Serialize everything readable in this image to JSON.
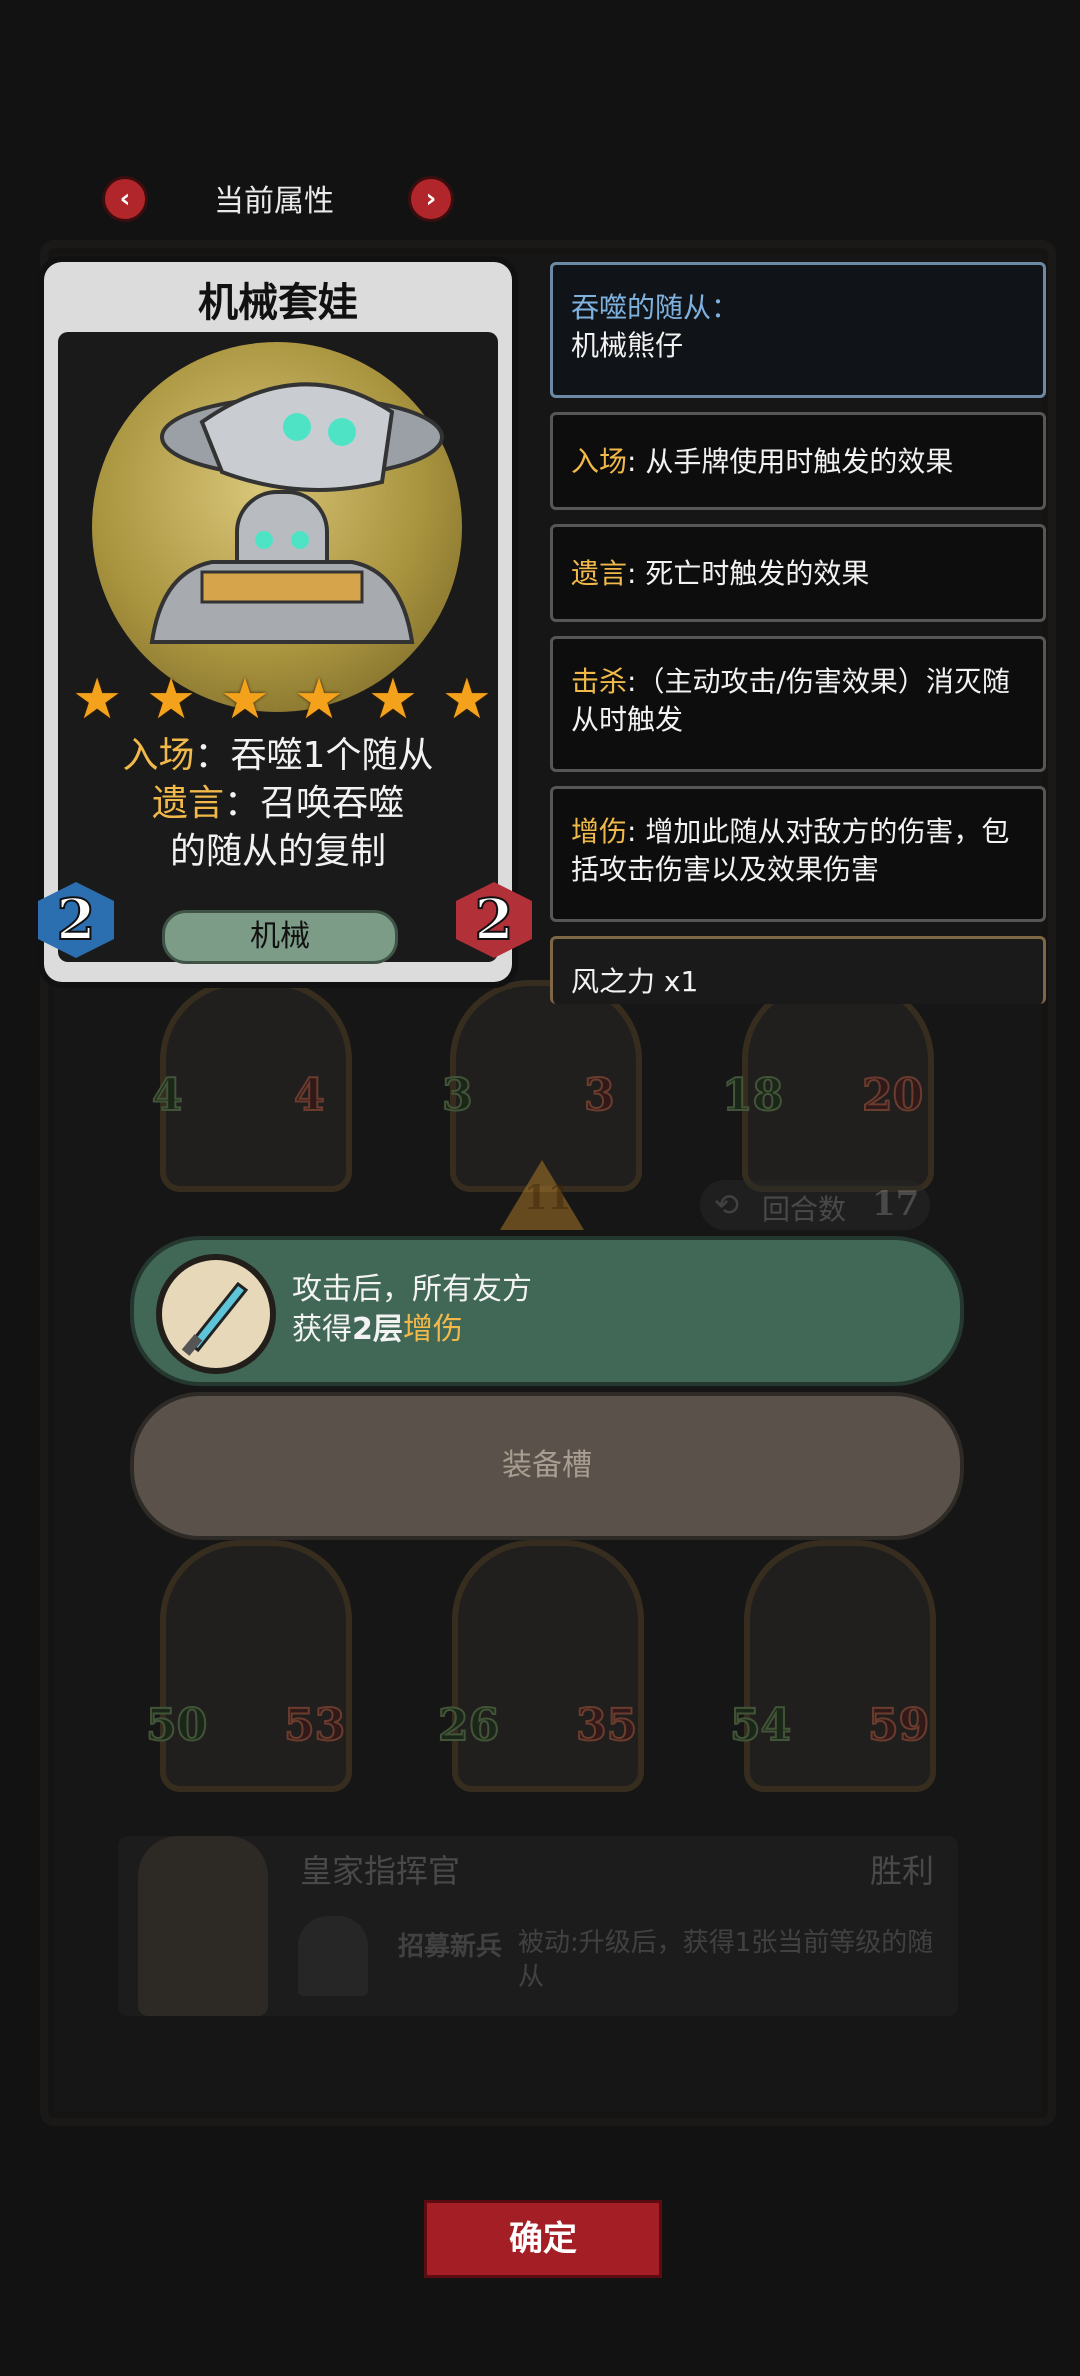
{
  "header": {
    "title": "当前属性"
  },
  "card": {
    "name": "机械套娃",
    "stars": 6,
    "battlecry_keyword": "入场",
    "battlecry_text": "：吞噬1个随从",
    "deathrattle_keyword": "遗言",
    "deathrattle_text_1": "：召唤吞噬",
    "deathrattle_text_2": "的随从的复制",
    "cost": "2",
    "attack": "2",
    "tribe": "机械"
  },
  "keywords": {
    "devoured_label": "吞噬的随从：",
    "devoured_value": "机械熊仔",
    "battlecry_k": "入场",
    "battlecry_v": ": 从手牌使用时触发的效果",
    "deathrattle_k": "遗言",
    "deathrattle_v": ": 死亡时触发的效果",
    "kill_k": "击杀",
    "kill_v": ":（主动攻击/伤害效果）消灭随从时触发",
    "dmg_k": "增伤",
    "dmg_v": ": 增加此随从对敌方的伤害，包括攻击伤害以及效果伤害",
    "wind": "风之力 x1"
  },
  "board": {
    "top_minions": [
      {
        "atk": "4",
        "hp": "4"
      },
      {
        "atk": "3",
        "hp": "3"
      },
      {
        "atk": "18",
        "hp": "20"
      }
    ],
    "tier": "11",
    "round_label": "回合数",
    "round_value": "17",
    "bottom_minions": [
      {
        "atk": "50",
        "hp": "53"
      },
      {
        "atk": "26",
        "hp": "35"
      },
      {
        "atk": "54",
        "hp": "59"
      }
    ],
    "hero_name": "皇家指挥官",
    "hero_status": "胜利",
    "hero_power_name": "招募新兵",
    "hero_power_text": "被动:升级后，获得1张当前等级的随从"
  },
  "effect": {
    "line1": "攻击后，所有友方",
    "line2_prefix": "获得",
    "line2_bold": "2层",
    "line2_keyword": "增伤"
  },
  "slot_label": "装备槽",
  "confirm_label": "确定",
  "colors": {
    "keyword_gold": "#f0b94a",
    "accent_red": "#a31f25",
    "effect_green": "#416756"
  }
}
